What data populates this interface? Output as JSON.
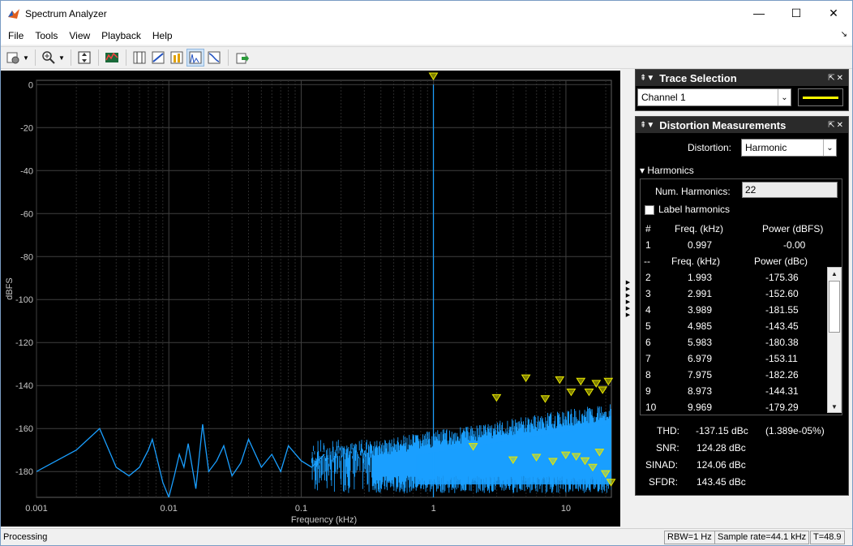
{
  "window": {
    "title": "Spectrum Analyzer",
    "minimize": "—",
    "maximize": "☐",
    "close": "✕"
  },
  "menu": [
    "File",
    "Tools",
    "View",
    "Playback",
    "Help"
  ],
  "colors": {
    "plot_bg": "#000000",
    "grid": "#404040",
    "spectrum": "#1a9fff",
    "marker": "#e8e800",
    "trace_line": "#ffff00"
  },
  "chart_data": {
    "type": "line",
    "xscale": "log",
    "xlabel": "Frequency (kHz)",
    "ylabel": "dBFS",
    "xlim": [
      0.001,
      22.05
    ],
    "ylim": [
      -192,
      2
    ],
    "xticks": [
      {
        "value": 0.001,
        "label": "0.001"
      },
      {
        "value": 0.01,
        "label": "0.01"
      },
      {
        "value": 0.1,
        "label": "0.1"
      },
      {
        "value": 1,
        "label": "1"
      },
      {
        "value": 10,
        "label": "10"
      }
    ],
    "yticks": [
      0,
      -20,
      -40,
      -60,
      -80,
      -100,
      -120,
      -140,
      -160,
      -180
    ],
    "grid": true,
    "fundamental": {
      "freq_khz": 0.997,
      "power_dbfs": 0
    },
    "noise_floor_low": [
      [
        0.001,
        -180
      ],
      [
        0.002,
        -170
      ],
      [
        0.003,
        -160
      ],
      [
        0.004,
        -178
      ],
      [
        0.005,
        -182
      ],
      [
        0.006,
        -178
      ],
      [
        0.007,
        -170
      ],
      [
        0.0075,
        -165
      ],
      [
        0.008,
        -172
      ],
      [
        0.009,
        -185
      ],
      [
        0.01,
        -192
      ],
      [
        0.011,
        -182
      ],
      [
        0.012,
        -172
      ],
      [
        0.013,
        -178
      ],
      [
        0.014,
        -167
      ],
      [
        0.016,
        -188
      ],
      [
        0.018,
        -158
      ],
      [
        0.02,
        -180
      ],
      [
        0.023,
        -175
      ],
      [
        0.026,
        -168
      ],
      [
        0.03,
        -182
      ],
      [
        0.035,
        -176
      ],
      [
        0.04,
        -165
      ],
      [
        0.05,
        -178
      ],
      [
        0.06,
        -172
      ],
      [
        0.07,
        -180
      ],
      [
        0.08,
        -168
      ],
      [
        0.1,
        -175
      ],
      [
        0.12,
        -178
      ],
      [
        0.15,
        -172
      ]
    ],
    "noise_band": {
      "x_start": 0.12,
      "x_end": 22.05,
      "floor_db": -192,
      "top_start_db": -170,
      "top_end_db": -148
    },
    "harmonic_markers": [
      [
        1.993,
        -175.36
      ],
      [
        2.991,
        -152.6
      ],
      [
        3.989,
        -181.55
      ],
      [
        4.985,
        -143.45
      ],
      [
        5.983,
        -180.38
      ],
      [
        6.979,
        -153.11
      ],
      [
        7.975,
        -182.26
      ],
      [
        8.973,
        -144.31
      ],
      [
        9.969,
        -179.29
      ],
      [
        10.96,
        -150
      ],
      [
        11.96,
        -180
      ],
      [
        12.95,
        -145
      ],
      [
        13.95,
        -182
      ],
      [
        14.95,
        -150
      ],
      [
        15.94,
        -185
      ],
      [
        16.94,
        -146
      ],
      [
        17.93,
        -178
      ],
      [
        18.93,
        -149
      ],
      [
        19.93,
        -188
      ],
      [
        20.92,
        -145
      ],
      [
        21.92,
        -192
      ]
    ],
    "markers_extra_left": [
      [
        0.997,
        2
      ]
    ]
  },
  "trace_selection": {
    "title": "Trace Selection",
    "channel": "Channel 1"
  },
  "distortion": {
    "title": "Distortion Measurements",
    "distortion_label": "Distortion:",
    "distortion_value": "Harmonic",
    "harmonics_section": "Harmonics",
    "num_harmonics_label": "Num. Harmonics:",
    "num_harmonics_value": "22",
    "label_harmonics": "Label harmonics",
    "header1": {
      "num": "#",
      "freq": "Freq. (kHz)",
      "power": "Power (dBFS)"
    },
    "fundamental_row": {
      "num": "1",
      "freq": "0.997",
      "power": "-0.00"
    },
    "header2": {
      "num": "--",
      "freq": "Freq. (kHz)",
      "power": "Power (dBc)"
    },
    "rows": [
      {
        "num": "2",
        "freq": "1.993",
        "power": "-175.36"
      },
      {
        "num": "3",
        "freq": "2.991",
        "power": "-152.60"
      },
      {
        "num": "4",
        "freq": "3.989",
        "power": "-181.55"
      },
      {
        "num": "5",
        "freq": "4.985",
        "power": "-143.45"
      },
      {
        "num": "6",
        "freq": "5.983",
        "power": "-180.38"
      },
      {
        "num": "7",
        "freq": "6.979",
        "power": "-153.11"
      },
      {
        "num": "8",
        "freq": "7.975",
        "power": "-182.26"
      },
      {
        "num": "9",
        "freq": "8.973",
        "power": "-144.31"
      },
      {
        "num": "10",
        "freq": "9.969",
        "power": "-179.29"
      }
    ],
    "thd_label": "THD:",
    "thd_value": "-137.15 dBc",
    "thd_pct": "(1.389e-05%)",
    "snr_label": "SNR:",
    "snr_value": "124.28 dBc",
    "sinad_label": "SINAD:",
    "sinad_value": "124.06 dBc",
    "sfdr_label": "SFDR:",
    "sfdr_value": "143.45 dBc"
  },
  "status": {
    "state": "Processing",
    "rbw": "RBW=1 Hz",
    "sample_rate": "Sample rate=44.1 kHz",
    "time": "T=48.9"
  }
}
